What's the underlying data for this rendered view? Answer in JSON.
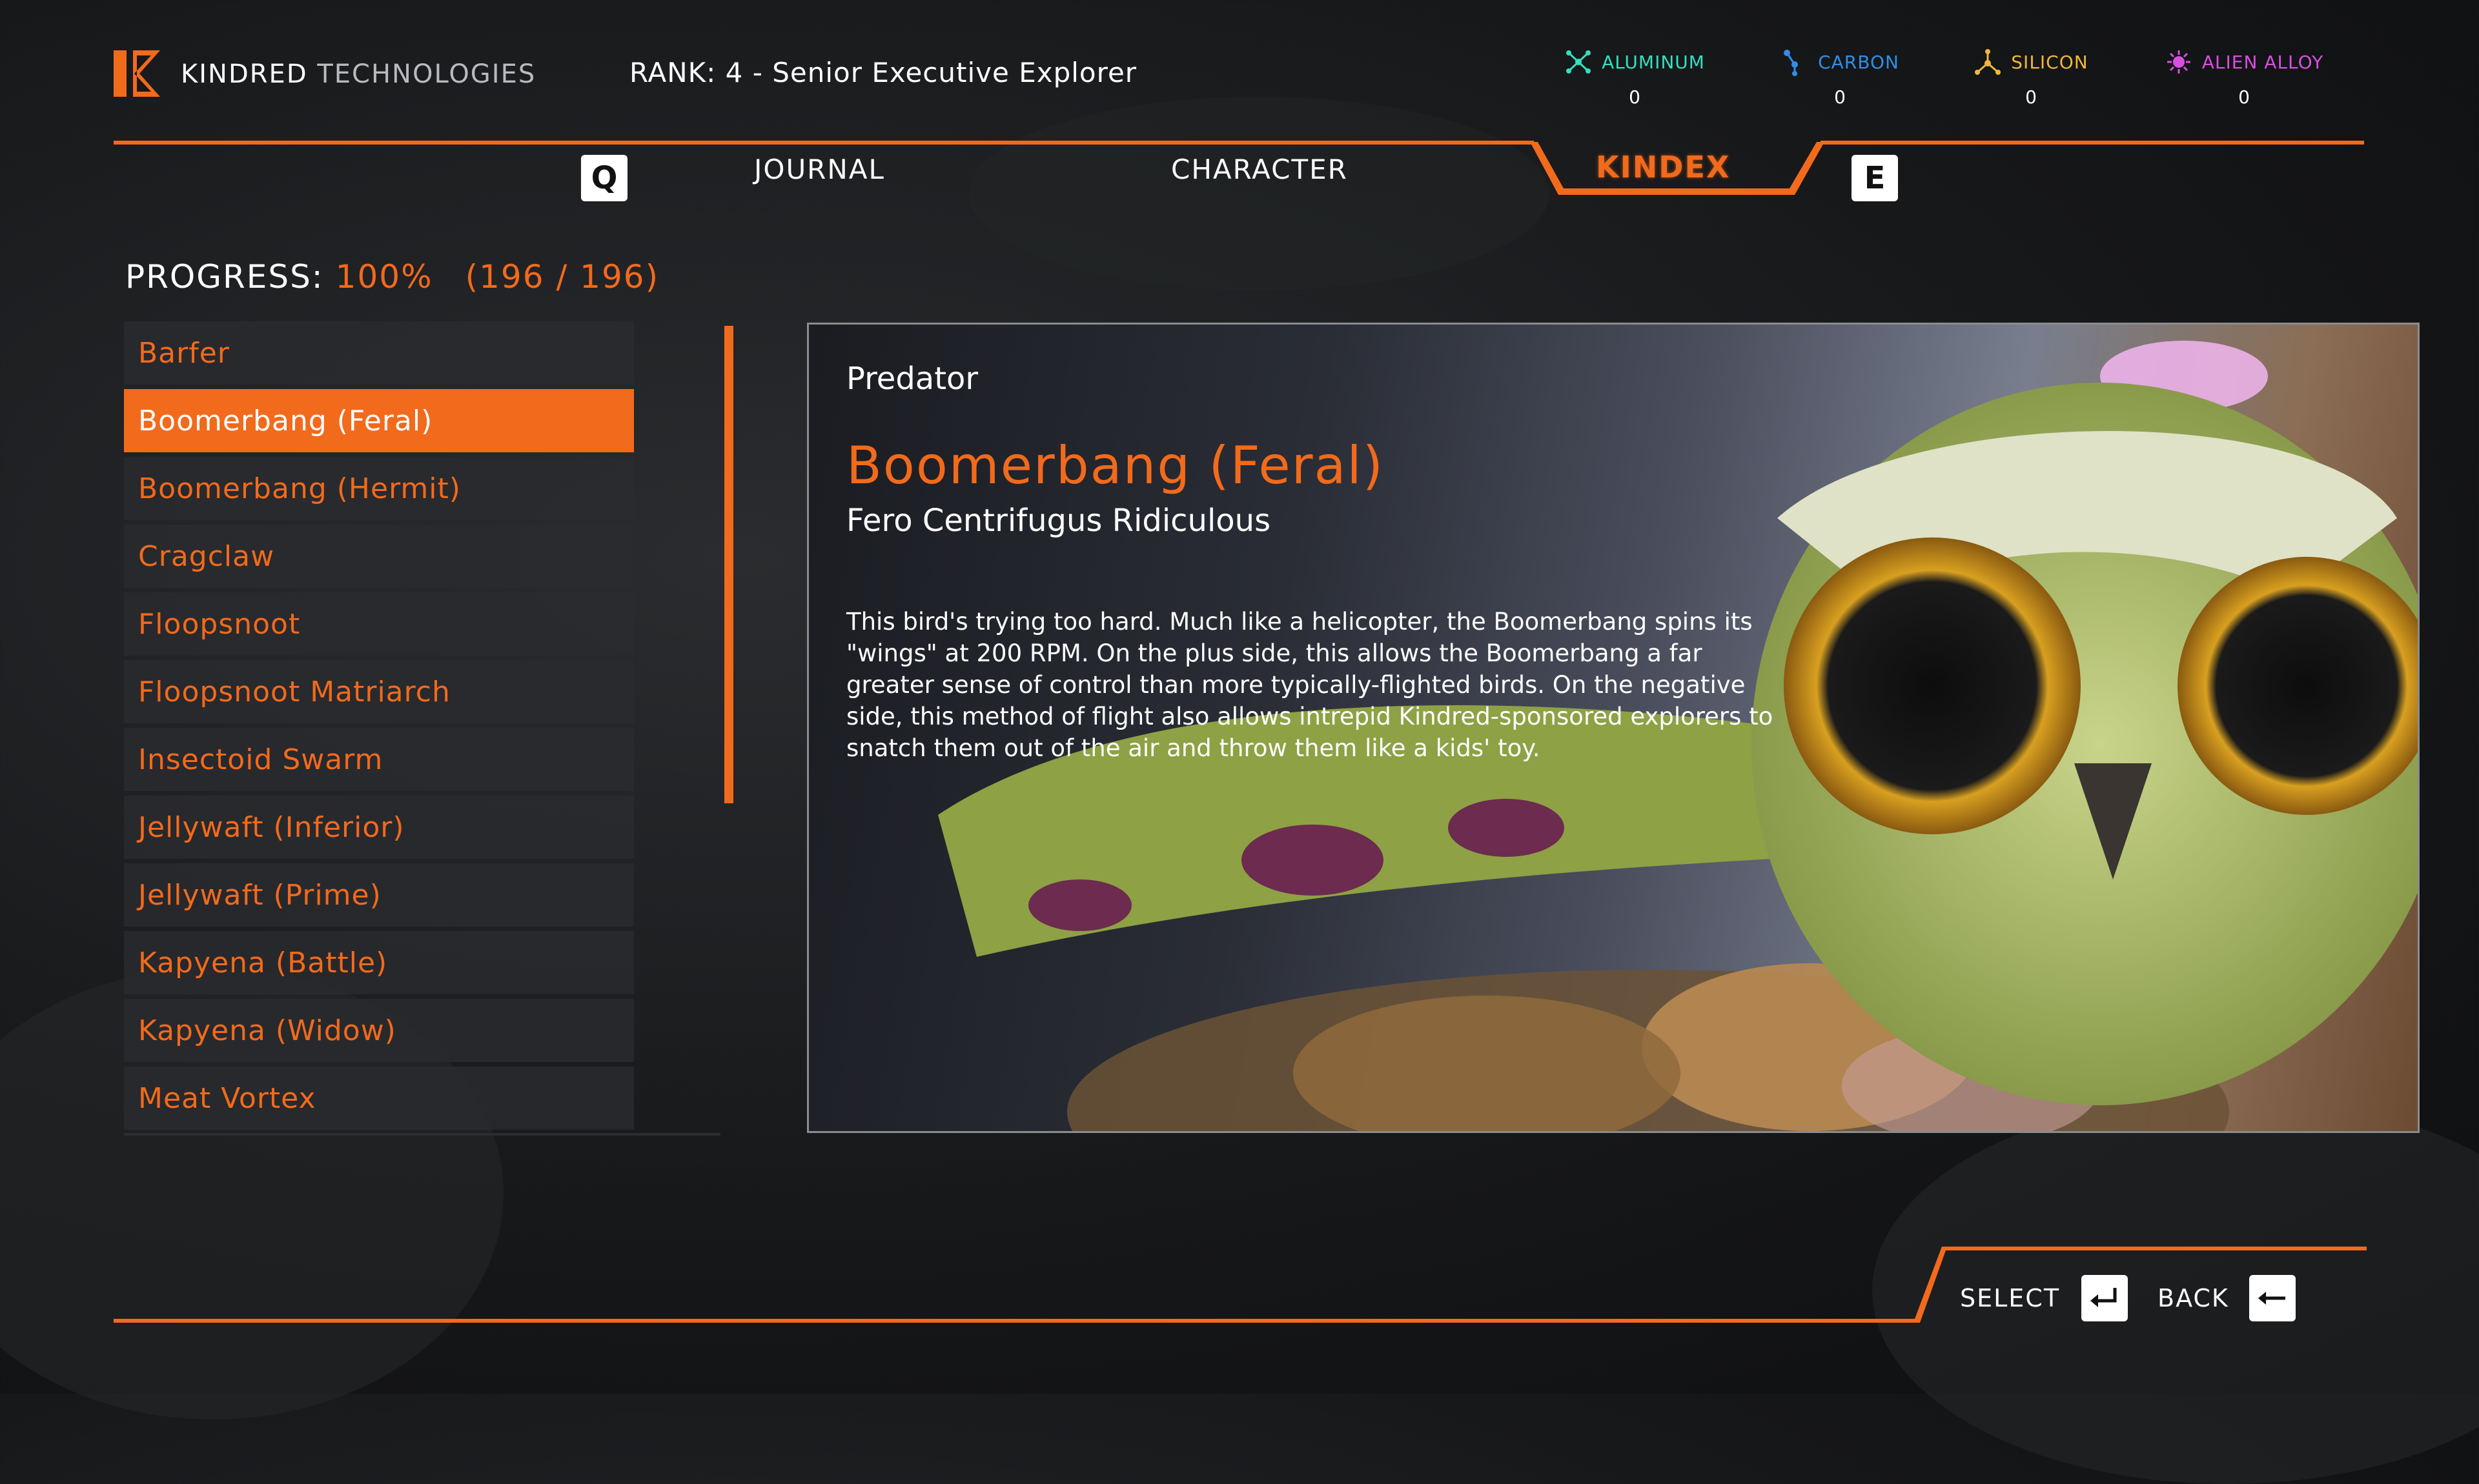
{
  "header": {
    "brand_primary": "KINDRED",
    "brand_secondary": "TECHNOLOGIES",
    "rank": "RANK: 4 - Senior Executive Explorer"
  },
  "resources": [
    {
      "label": "ALUMINUM",
      "value": "0",
      "color": "#33e0c0",
      "icon": "aluminum-icon"
    },
    {
      "label": "CARBON",
      "value": "0",
      "color": "#2f8fe8",
      "icon": "carbon-icon"
    },
    {
      "label": "SILICON",
      "value": "0",
      "color": "#f0b83a",
      "icon": "silicon-icon"
    },
    {
      "label": "ALIEN ALLOY",
      "value": "0",
      "color": "#d84fe0",
      "icon": "alien-alloy-icon"
    }
  ],
  "tabs": {
    "prev_key": "Q",
    "journal": "JOURNAL",
    "character": "CHARACTER",
    "kindex": "KINDEX",
    "next_key": "E"
  },
  "progress": {
    "label": "PROGRESS:",
    "percent": "100%",
    "count": "(196 / 196)"
  },
  "entries": [
    "Barfer",
    "Boomerbang (Feral)",
    "Boomerbang (Hermit)",
    "Cragclaw",
    "Floopsnoot",
    "Floopsnoot Matriarch",
    "Insectoid Swarm",
    "Jellywaft (Inferior)",
    "Jellywaft (Prime)",
    "Kapyena (Battle)",
    "Kapyena (Widow)",
    "Meat Vortex"
  ],
  "detail": {
    "category": "Predator",
    "name": "Boomerbang (Feral)",
    "scientific": "Fero Centrifugus Ridiculous",
    "description": "This bird's trying too hard. Much like a helicopter, the Boomerbang spins its \"wings\" at 200 RPM. On the plus side, this allows the Boomerbang a far greater sense of control than more typically-flighted birds. On the negative side, this method of flight also allows intrepid Kindred-sponsored explorers to snatch them out of the air and throw them like a kids' toy."
  },
  "footer": {
    "select": "SELECT",
    "back": "BACK"
  },
  "colors": {
    "accent": "#f26a1b",
    "panel_border": "#8a8c8f"
  }
}
